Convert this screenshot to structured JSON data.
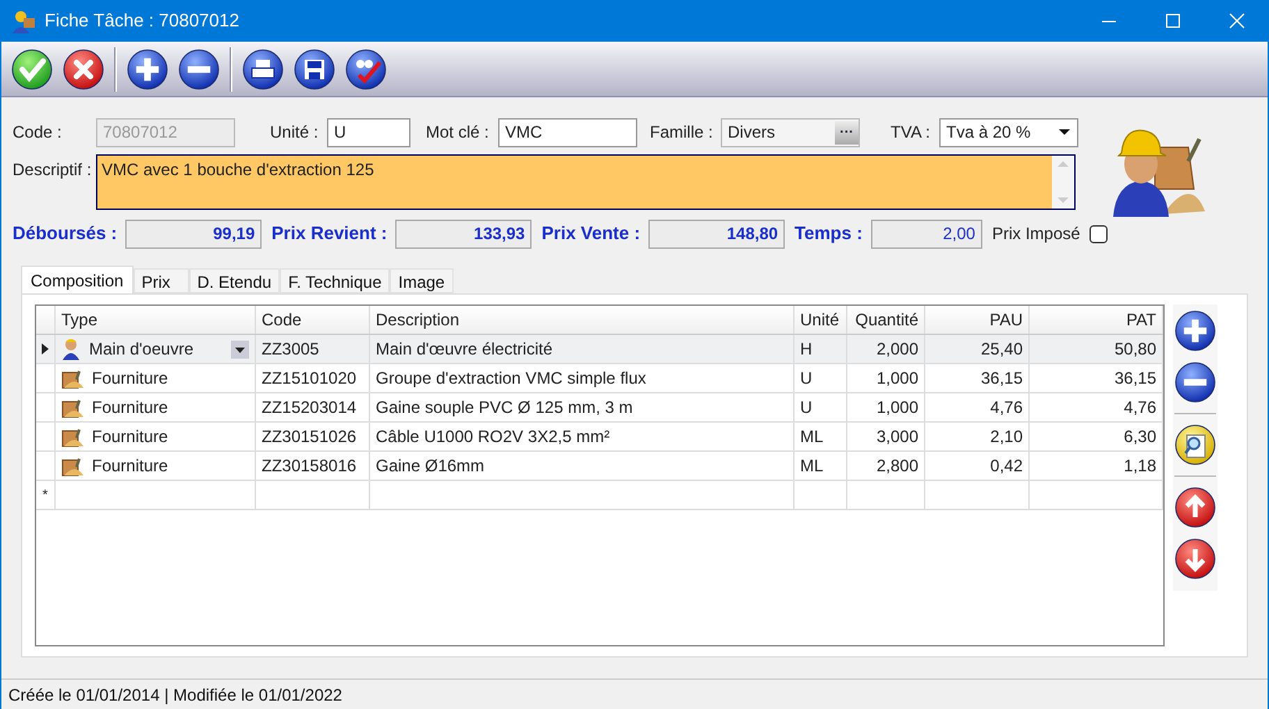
{
  "window": {
    "title": "Fiche Tâche : 70807012"
  },
  "toolbar": [
    {
      "kind": "ok"
    },
    {
      "kind": "cancel"
    },
    {
      "kind": "sep"
    },
    {
      "kind": "add"
    },
    {
      "kind": "remove"
    },
    {
      "kind": "sep"
    },
    {
      "kind": "print"
    },
    {
      "kind": "save"
    },
    {
      "kind": "spell"
    }
  ],
  "form": {
    "code": {
      "label": "Code :",
      "value": "70807012",
      "disabled": true
    },
    "unite": {
      "label": "Unité :",
      "value": "U"
    },
    "mot_cle": {
      "label": "Mot clé :",
      "value": "VMC"
    },
    "famille": {
      "label": "Famille :",
      "value": "Divers",
      "button": "···"
    },
    "tva": {
      "label": "TVA :",
      "value": "Tva à 20 %"
    },
    "descriptif": {
      "label": "Descriptif :",
      "value": "VMC avec 1 bouche d'extraction 125"
    },
    "totals": [
      {
        "label": "Déboursés :",
        "value": "99,19"
      },
      {
        "label": "Prix Revient :",
        "value": "133,93"
      },
      {
        "label": "Prix Vente :",
        "value": "148,80"
      },
      {
        "label": "Temps :",
        "value": "2,00"
      }
    ],
    "prix_impose": {
      "label": "Prix Imposé",
      "checked": false
    }
  },
  "tabs": [
    {
      "label": "Composition",
      "selected": true
    },
    {
      "label": "Prix",
      "selected": false
    },
    {
      "label": "D. Etendu",
      "selected": false
    },
    {
      "label": "F. Technique",
      "selected": false
    },
    {
      "label": "Image",
      "selected": false
    }
  ],
  "table": {
    "columns": [
      "Type",
      "Code",
      "Description",
      "Unité",
      "Quantité",
      "PAU",
      "PAT"
    ],
    "rows": [
      {
        "kind": "labour",
        "selected": true,
        "type": "Main d'oeuvre",
        "code": "ZZ3005",
        "description": "Main d'œuvre électricité",
        "unite": "H",
        "quantite": "2,000",
        "pau": "25,40",
        "pat": "50,80"
      },
      {
        "kind": "supply",
        "selected": false,
        "type": "Fourniture",
        "code": "ZZ15101020",
        "description": "Groupe d'extraction VMC simple flux",
        "unite": "U",
        "quantite": "1,000",
        "pau": "36,15",
        "pat": "36,15"
      },
      {
        "kind": "supply",
        "selected": false,
        "type": "Fourniture",
        "code": "ZZ15203014",
        "description": "Gaine souple PVC Ø 125 mm, 3 m",
        "unite": "U",
        "quantite": "1,000",
        "pau": "4,76",
        "pat": "4,76"
      },
      {
        "kind": "supply",
        "selected": false,
        "type": "Fourniture",
        "code": "ZZ30151026",
        "description": "Câble U1000 RO2V 3X2,5 mm²",
        "unite": "ML",
        "quantite": "3,000",
        "pau": "2,10",
        "pat": "6,30"
      },
      {
        "kind": "supply",
        "selected": false,
        "type": "Fourniture",
        "code": "ZZ30158016",
        "description": "Gaine Ø16mm",
        "unite": "ML",
        "quantite": "2,800",
        "pau": "0,42",
        "pat": "1,18"
      }
    ],
    "new_row_marker": "*"
  },
  "side_buttons": [
    {
      "kind": "add"
    },
    {
      "kind": "remove"
    },
    {
      "kind": "sep"
    },
    {
      "kind": "search"
    },
    {
      "kind": "sep"
    },
    {
      "kind": "up"
    },
    {
      "kind": "down"
    }
  ],
  "status_bar": "Créée le 01/01/2014 | Modifiée le 01/01/2022"
}
